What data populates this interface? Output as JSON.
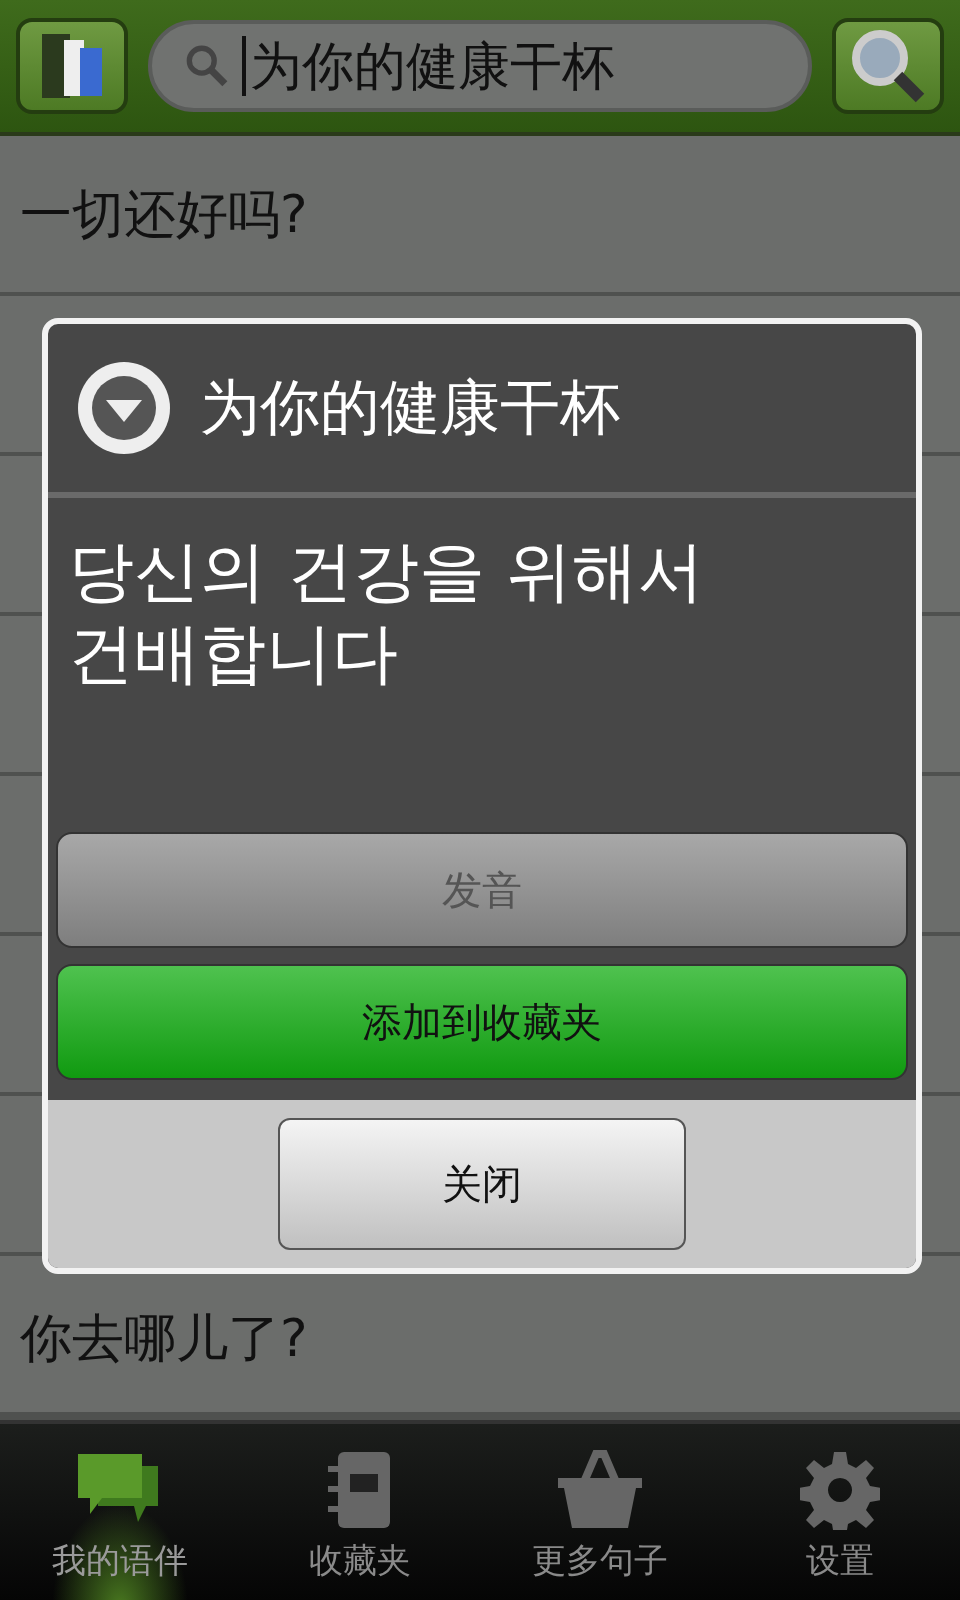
{
  "search": {
    "value": "为你的健康干杯"
  },
  "phrases": [
    {
      "text": "一切还好吗?"
    },
    {
      "text": "你去哪儿了?"
    }
  ],
  "dialog": {
    "title": "为你的健康干杯",
    "message": "당신의 건강을 위해서 건배합니다",
    "buttons": [
      {
        "label": "发音",
        "kind": "plain",
        "disabled": true
      },
      {
        "label": "添加到收藏夹",
        "kind": "primary",
        "disabled": false
      }
    ],
    "close": "关闭"
  },
  "tabs": [
    {
      "label": "我的语伴",
      "selected": true
    },
    {
      "label": "收藏夹",
      "selected": false
    },
    {
      "label": "更多句子",
      "selected": false
    },
    {
      "label": "设置",
      "selected": false
    }
  ]
}
